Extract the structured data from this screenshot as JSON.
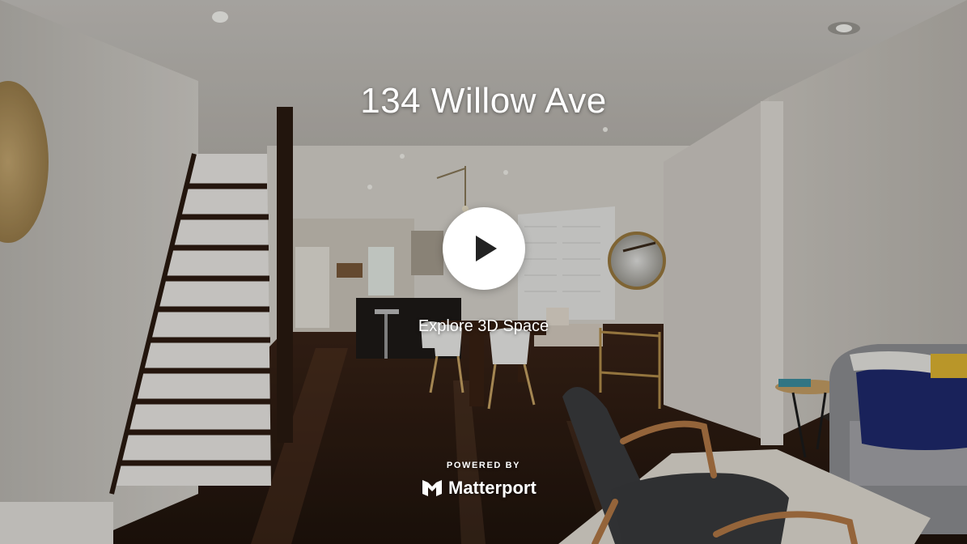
{
  "listing": {
    "title": "134 Willow Ave"
  },
  "player": {
    "play_icon": "play-icon",
    "cta_label": "Explore 3D Space"
  },
  "branding": {
    "powered_by": "POWERED BY",
    "name": "Matterport",
    "logo_icon": "matterport-logo-icon"
  },
  "colors": {
    "overlay_text": "#ffffff",
    "play_button_bg": "#ffffff",
    "play_icon": "#222222"
  }
}
